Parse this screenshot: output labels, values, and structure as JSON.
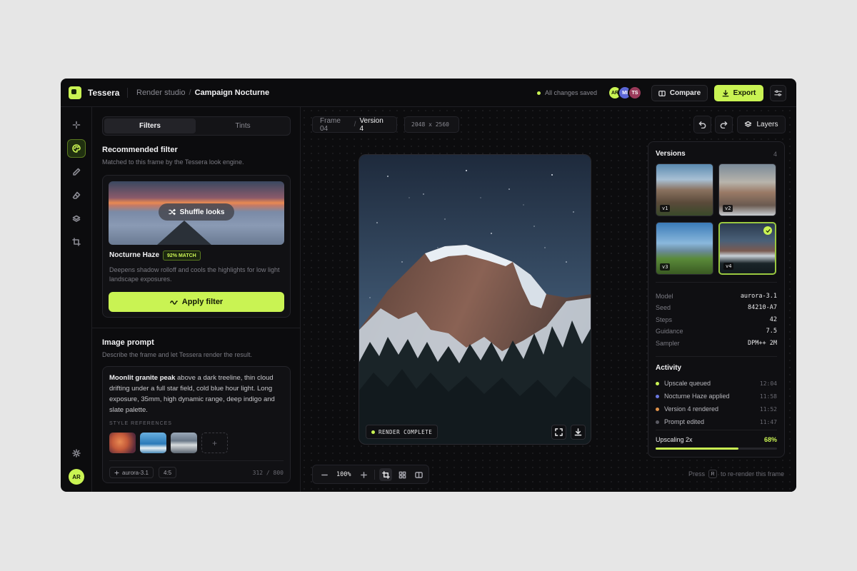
{
  "app": {
    "name": "Tessera"
  },
  "breadcrumb": {
    "section": "Render studio",
    "project": "Campaign Nocturne"
  },
  "header": {
    "status": "All changes saved",
    "avatars": [
      {
        "initials": "AR",
        "color": "#c9f353"
      },
      {
        "initials": "MI",
        "color": "#5b67d6"
      },
      {
        "initials": "TS",
        "color": "#9a3a5a"
      }
    ],
    "compare_label": "Compare",
    "export_label": "Export"
  },
  "rail": {
    "icons": [
      "sparkle-icon",
      "palette-icon",
      "pencil-icon",
      "eraser-icon",
      "layers-icon",
      "crop-icon"
    ],
    "avatar": "AR"
  },
  "left_panel": {
    "tabs": [
      {
        "label": "Filters",
        "active": true
      },
      {
        "label": "Tints",
        "active": false
      }
    ],
    "recommended": {
      "title": "Recommended filter",
      "subtitle": "Matched to this frame by the Tessera look engine.",
      "shuffle_label": "Shuffle looks",
      "filter_name": "Nocturne Haze",
      "match_badge": "92% MATCH",
      "match_value": 0.92,
      "description": "Deepens shadow rolloff and cools the highlights for low light landscape exposures.",
      "apply_label": "Apply filter"
    },
    "prompt": {
      "title": "Image prompt",
      "subtitle": "Describe the frame and let Tessera render the result.",
      "text_strong": "Moonlit granite peak",
      "text_rest": " above a dark treeline, thin cloud drifting under a full star field, cold blue hour light. Long exposure, 35mm, high dynamic range, deep indigo and slate palette.",
      "refs_label": "STYLE REFERENCES",
      "add_ref": "+",
      "model_chip": "aurora-3.1",
      "ratio_chip": "4:5",
      "char_count": "312 / 800"
    }
  },
  "canvas": {
    "frame": "Frame 04",
    "version": "Version 4",
    "dimensions": "2048 x 2560",
    "layers_label": "Layers",
    "render_status": "RENDER COMPLETE",
    "zoom": "100%",
    "hint_press": "Press",
    "hint_key": "R",
    "hint_rest": "to re-render this frame"
  },
  "versions": {
    "title": "Versions",
    "count": "4",
    "items": [
      {
        "label": "v1",
        "selected": false
      },
      {
        "label": "v2",
        "selected": false
      },
      {
        "label": "v3",
        "selected": false
      },
      {
        "label": "v4",
        "selected": true
      }
    ]
  },
  "details": [
    {
      "key": "Model",
      "value": "aurora-3.1"
    },
    {
      "key": "Seed",
      "value": "84210-A7"
    },
    {
      "key": "Steps",
      "value": "42"
    },
    {
      "key": "Guidance",
      "value": "7.5"
    },
    {
      "key": "Sampler",
      "value": "DPM++ 2M"
    }
  ],
  "activity": {
    "title": "Activity",
    "items": [
      {
        "text": "Upscale queued",
        "time": "12:04",
        "color": "#c9f353"
      },
      {
        "text": "Nocturne Haze applied",
        "time": "11:58",
        "color": "#6a78e0"
      },
      {
        "text": "Version 4 rendered",
        "time": "11:52",
        "color": "#e0924a"
      },
      {
        "text": "Prompt edited",
        "time": "11:47",
        "color": "#5a5a62"
      }
    ]
  },
  "upscale": {
    "label": "Upscaling 2x",
    "percent": "68%",
    "value": 0.68
  }
}
